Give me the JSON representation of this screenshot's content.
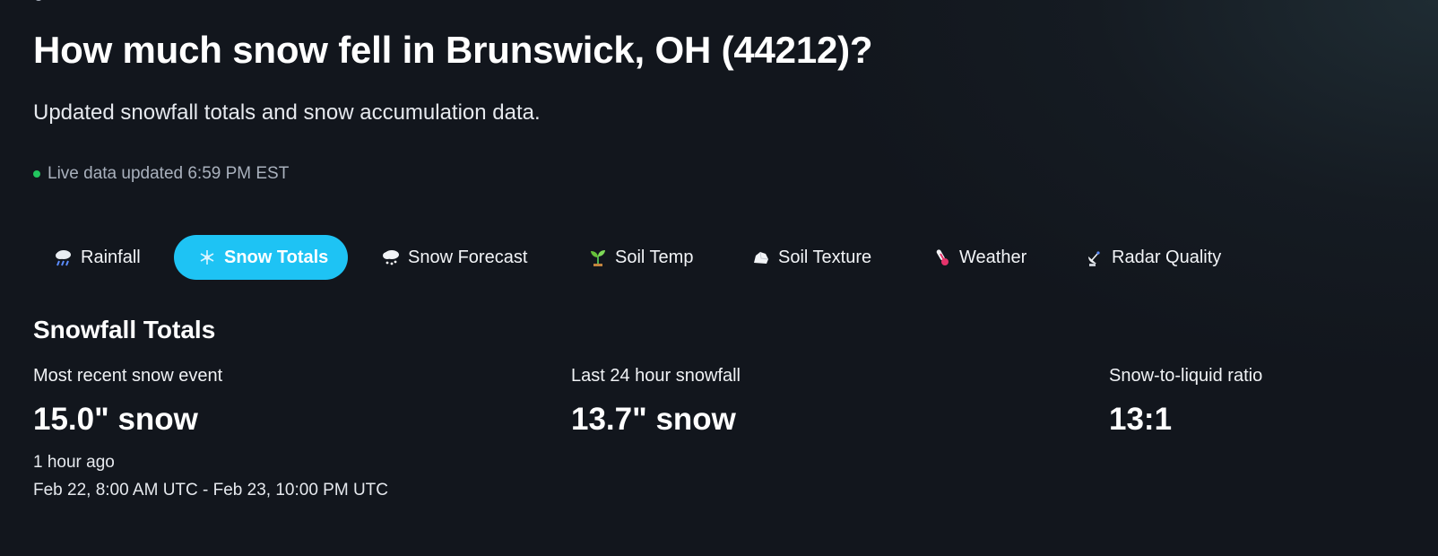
{
  "page": {
    "title": "How much snow fell in Brunswick, OH (44212)?",
    "subtitle": "Updated snowfall totals and snow accumulation data.",
    "live_status": "Live data updated 6:59 PM EST"
  },
  "tabs": [
    {
      "label": "Rainfall",
      "icon": "rain-cloud-icon",
      "active": false
    },
    {
      "label": "Snow Totals",
      "icon": "snowflake-icon",
      "active": true
    },
    {
      "label": "Snow Forecast",
      "icon": "snow-cloud-icon",
      "active": false
    },
    {
      "label": "Soil Temp",
      "icon": "seedling-icon",
      "active": false
    },
    {
      "label": "Soil Texture",
      "icon": "rock-icon",
      "active": false
    },
    {
      "label": "Weather",
      "icon": "thermometer-icon",
      "active": false
    },
    {
      "label": "Radar Quality",
      "icon": "satellite-dish-icon",
      "active": false
    }
  ],
  "snowfall": {
    "heading": "Snowfall Totals",
    "recent": {
      "label": "Most recent snow event",
      "value": "15.0\" snow",
      "ago": "1 hour ago",
      "range": "Feb 22, 8:00 AM UTC - Feb 23, 10:00 PM UTC"
    },
    "last24": {
      "label": "Last 24 hour snowfall",
      "value": "13.7\" snow"
    },
    "ratio": {
      "label": "Snow-to-liquid ratio",
      "value": "13:1"
    }
  },
  "colors": {
    "accent": "#1ec3f4",
    "background": "#12161d",
    "live": "#22c55e"
  }
}
